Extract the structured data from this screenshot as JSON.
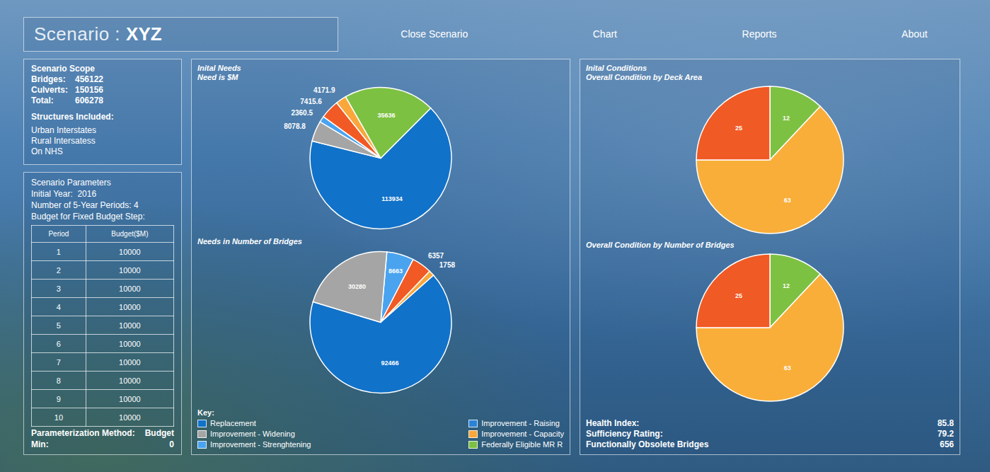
{
  "header": {
    "title_prefix": "Scenario :",
    "title_name": "XYZ",
    "menu": [
      "Close Scenario",
      "Chart",
      "Reports",
      "About"
    ]
  },
  "scope": {
    "heading": "Scenario Scope",
    "counts": [
      {
        "label": "Bridges:",
        "value": "456122"
      },
      {
        "label": "Culverts:",
        "value": "150156"
      },
      {
        "label": "Total:",
        "value": "606278"
      }
    ],
    "included_heading": "Structures Included:",
    "included": [
      "Urban Interstates",
      "Rural Intersatess",
      "On NHS"
    ]
  },
  "parameters": {
    "heading": "Scenario Parameters",
    "lines": [
      "Initial Year:  2016",
      "Number of 5-Year Periods: 4",
      "Budget for Fixed Budget Step:"
    ],
    "table": {
      "columns": [
        "Period",
        "Budget($M)"
      ],
      "rows": [
        [
          "1",
          "10000"
        ],
        [
          "2",
          "10000"
        ],
        [
          "3",
          "10000"
        ],
        [
          "4",
          "10000"
        ],
        [
          "5",
          "10000"
        ],
        [
          "6",
          "10000"
        ],
        [
          "7",
          "10000"
        ],
        [
          "8",
          "10000"
        ],
        [
          "9",
          "10000"
        ],
        [
          "10",
          "10000"
        ]
      ]
    },
    "footer": [
      {
        "label": "Parameterization Method:",
        "value": "Budget"
      },
      {
        "label": "Min:",
        "value": "0"
      }
    ]
  },
  "needs": {
    "charts": [
      {
        "titles": [
          "Inital Needs",
          "Need is $M"
        ],
        "slices": [
          {
            "label": "113934",
            "value": 113934,
            "color": "#1172c9"
          },
          {
            "label": "8078.8",
            "value": 8078.8,
            "color": "#a5a5a5"
          },
          {
            "label": "2360.5",
            "value": 2360.5,
            "color": "#4aa3ef"
          },
          {
            "label": "7415.6",
            "value": 7415.6,
            "color": "#f15a24"
          },
          {
            "label": "4171.9",
            "value": 4171.9,
            "color": "#f9a73b"
          },
          {
            "label": "35636",
            "value": 35636,
            "color": "#7dc142"
          }
        ]
      },
      {
        "titles": [
          "Needs in Number of Bridges"
        ],
        "slices": [
          {
            "label": "8663",
            "value": 8663,
            "color": "#4aa3ef"
          },
          {
            "label": "6357",
            "value": 6357,
            "color": "#f15a24"
          },
          {
            "label": "1758",
            "value": 1758,
            "color": "#f9a73b"
          },
          {
            "label": "92466",
            "value": 92466,
            "color": "#1172c9"
          },
          {
            "label": "30280",
            "value": 30280,
            "color": "#a5a5a5"
          }
        ]
      }
    ],
    "key": {
      "title": "Key:",
      "items": [
        {
          "label": "Replacement",
          "color": "#1172c9"
        },
        {
          "label": "Improvement - Widening",
          "color": "#a5a5a5"
        },
        {
          "label": "Improvement - Strenghtening",
          "color": "#4aa3ef"
        },
        {
          "label": "Improvement - Raising",
          "color": "#2a83d6"
        },
        {
          "label": "Improvement - Capacity",
          "color": "#f9a73b"
        },
        {
          "label": "Federally Eligible MR R",
          "color": "#7dc142"
        }
      ]
    }
  },
  "conditions": {
    "charts": [
      {
        "titles": [
          "Inital Conditions",
          "Overall Condition by Deck Area"
        ],
        "slices": [
          {
            "label": "12",
            "value": 12,
            "color": "#7dc142"
          },
          {
            "label": "63",
            "value": 63,
            "color": "#f9ae3a"
          },
          {
            "label": "25",
            "value": 25,
            "color": "#f05a24"
          }
        ]
      },
      {
        "titles": [
          "Overall Condition by Number of Bridges"
        ],
        "slices": [
          {
            "label": "12",
            "value": 12,
            "color": "#7dc142"
          },
          {
            "label": "63",
            "value": 63,
            "color": "#f9ae3a"
          },
          {
            "label": "25",
            "value": 25,
            "color": "#f05a24"
          }
        ]
      }
    ],
    "stats": [
      {
        "label": "Health Index:",
        "value": "85.8"
      },
      {
        "label": "Sufficiency Rating:",
        "value": "79.2"
      },
      {
        "label": "Functionally Obsolete Bridges",
        "value": "656"
      }
    ]
  }
}
